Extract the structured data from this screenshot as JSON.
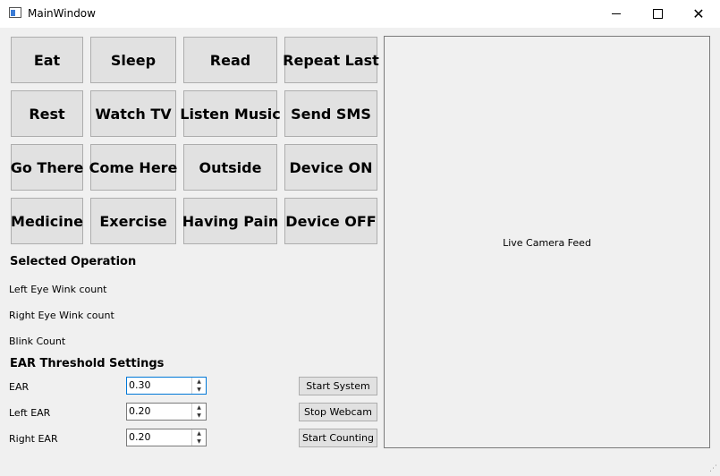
{
  "window": {
    "title": "MainWindow",
    "controls": {
      "minimize": "minimize",
      "maximize": "maximize",
      "close": "close"
    }
  },
  "commands": [
    [
      "Eat",
      "Sleep",
      "Read",
      "Repeat Last"
    ],
    [
      "Rest",
      "Watch TV",
      "Listen Music",
      "Send SMS"
    ],
    [
      "Go There",
      "Come Here",
      "Outside",
      "Device ON"
    ],
    [
      "Medicine",
      "Exercise",
      "Having Pain",
      "Device OFF"
    ]
  ],
  "status": {
    "selected_operation": "Selected Operation",
    "left_wink": "Left Eye Wink count",
    "right_wink": "Right Eye Wink count",
    "blink": "Blink Count"
  },
  "thresholds": {
    "heading": "EAR Threshold Settings",
    "ear_label": "EAR",
    "ear_value": "0.30",
    "left_label": "Left EAR",
    "left_value": "0.20",
    "right_label": "Right EAR",
    "right_value": "0.20"
  },
  "actions": {
    "start_system": "Start System",
    "stop_webcam": "Stop Webcam",
    "start_counting": "Start Counting"
  },
  "camera": {
    "label": "Live Camera Feed"
  },
  "colors": {
    "accent_focus": "#0078d7",
    "button_face": "#e1e1e1"
  }
}
